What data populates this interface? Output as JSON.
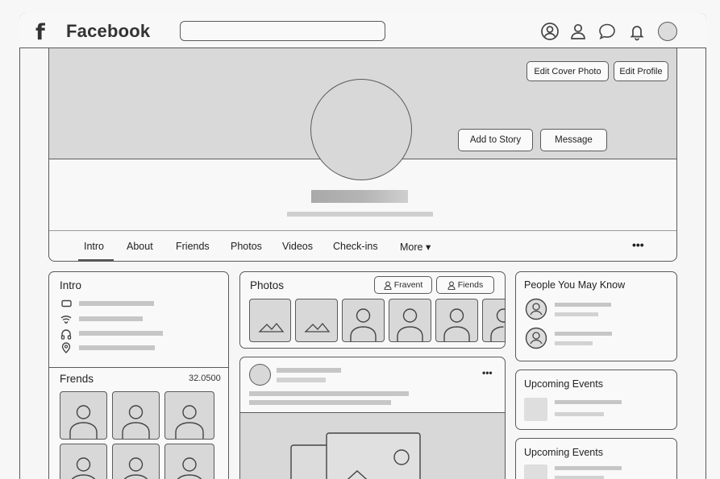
{
  "app": {
    "logo_glyph": "f",
    "brand": "Facebook"
  },
  "search": {
    "placeholder": ""
  },
  "top_icons": [
    "account-circle-icon",
    "person-icon",
    "chat-bubble-icon",
    "bell-icon",
    "profile-avatar"
  ],
  "cover": {
    "edit_cover_label": "Edit Cover Photo",
    "edit_profile_label": "Edit Profile",
    "add_story_label": "Add to Story",
    "message_label": "Message"
  },
  "tabs": [
    "Intro",
    "About",
    "Friends",
    "Photos",
    "Videos",
    "Check-ins",
    "More ▾"
  ],
  "tabs_more_menu": "•••",
  "intro": {
    "title": "Intro",
    "icons": [
      "card-icon",
      "wifi-icon",
      "headphones-icon",
      "location-pin-icon"
    ]
  },
  "friends": {
    "title": "Frends",
    "count": "32.0500"
  },
  "photos": {
    "title": "Photos",
    "filter1": "Fravent",
    "filter2": "Fiends"
  },
  "post": {
    "menu": "•••"
  },
  "people": {
    "title": "People You May Know"
  },
  "events1": {
    "title": "Upcoming Events"
  },
  "events2": {
    "title": "Upcoming Events"
  }
}
